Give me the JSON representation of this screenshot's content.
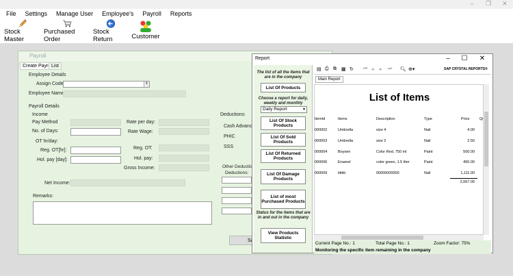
{
  "menu": [
    "File",
    "Settings",
    "Manage User",
    "Employee's",
    "Payroll",
    "Reports"
  ],
  "toolbar": [
    {
      "label": "Stock Master",
      "icon": "pencil-icon"
    },
    {
      "label": "Purchased Order",
      "icon": "cart-icon"
    },
    {
      "label": "Stock Return",
      "icon": "back-arrow-icon"
    },
    {
      "label": "Customer",
      "icon": "people-icon"
    }
  ],
  "payroll": {
    "title": "Payroll",
    "tabs": [
      "Create Payroll",
      "List"
    ],
    "employee_details": "Employee Details",
    "assign_code": "Assign Code:",
    "employee_name": "Employee Name:",
    "payroll_details": "Payroll Details",
    "income": "Income",
    "pay_method": "Pay Method",
    "no_days": "No. of Days:",
    "ot_hr_day": "OT hr/day:",
    "reg_ot_hr": "Reg. OT[hr]:",
    "hol_pay_day": "Hol. pay [day]:",
    "rate_per_day": "Rate per day:",
    "rate_wage": "Rate Wage:",
    "reg_ot": "Reg. OT:",
    "hol_pay": "Hol. pay:",
    "gross_income": "Gross Income:",
    "net_income": "Net Income:",
    "remarks": "Remarks:",
    "deductions": "Deductions:",
    "cash_advance": "Cash Advance:",
    "phic": "PHIC",
    "sss": "SSS",
    "other_deductions": "Other Deductions",
    "deductions2": "Deductions:",
    "save_partial": "Sa"
  },
  "report": {
    "title": "Report",
    "intro": "The list of all the items that are in the company",
    "btn_list_products": "List Of Products",
    "choose": "Choose a report for daily, weekly and monthly",
    "period_selected": "Daily Report",
    "btn_stock": "List Of Stock Products",
    "btn_sold": "List Of Sold Products",
    "btn_returned": "List Of Returned Products",
    "btn_damage": "List Of Damage Products",
    "btn_most": "List of most Purchased Products",
    "status_text": "Status for the items that are in and out in the company",
    "btn_view_stats": "View Products Statistic",
    "sap": "SAP CRYSTAL REPORTS®",
    "main_tab": "Main Report",
    "page_title": "List of Items",
    "columns": [
      "ItemId",
      "Items",
      "Description",
      "Type",
      "Price",
      "Qu"
    ],
    "rows": [
      [
        "000002",
        "Umbrella",
        "size 4",
        "Nail",
        "4.00"
      ],
      [
        "000003",
        "Umbrella",
        "size 2",
        "Nail",
        "2.50"
      ],
      [
        "000004",
        "Boysen",
        "Color Red, 750 ml",
        "Paint",
        "500.00"
      ],
      [
        "000006",
        "Enamel",
        "color green, 1.5 liter",
        "Paint",
        "450.00"
      ],
      [
        "000009",
        "titititi",
        "00000000000",
        "Nail",
        "1,111.00"
      ]
    ],
    "total": "2,067.00",
    "current_page": "Current Page No.: 1",
    "total_page": "Total Page No.: 1",
    "zoom": "Zoom Factor: 75%",
    "bottom_msg": "Monitoring the specific item remaining in the company"
  }
}
